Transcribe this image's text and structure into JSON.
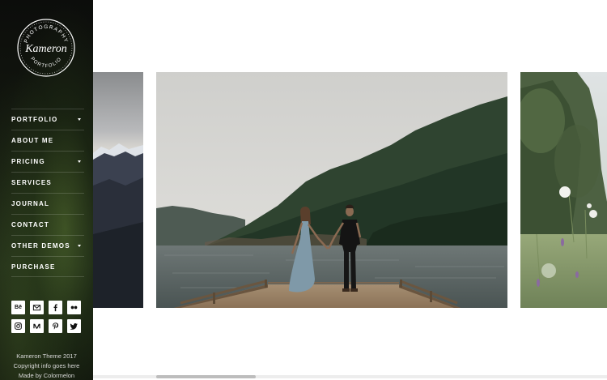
{
  "logo": {
    "top_text": "PHOTOGRAPHY",
    "script_text": "Kameron",
    "bottom_text": "PORTFOLIO"
  },
  "nav": [
    {
      "label": "PORTFOLIO",
      "has_dropdown": true
    },
    {
      "label": "ABOUT ME",
      "has_dropdown": false
    },
    {
      "label": "PRICING",
      "has_dropdown": true
    },
    {
      "label": "SERVICES",
      "has_dropdown": false
    },
    {
      "label": "JOURNAL",
      "has_dropdown": false
    },
    {
      "label": "CONTACT",
      "has_dropdown": false
    },
    {
      "label": "OTHER DEMOS",
      "has_dropdown": true
    },
    {
      "label": "PURCHASE",
      "has_dropdown": false
    }
  ],
  "social": {
    "behance": "Bē",
    "icons_row1": [
      "behance-icon",
      "envelope-icon",
      "facebook-icon",
      "flickr-icon"
    ],
    "icons_row2": [
      "instagram-icon",
      "medium-icon",
      "pinterest-icon",
      "twitter-icon"
    ]
  },
  "footer": {
    "line1": "Kameron Theme 2017",
    "line2": "Copyright info goes here",
    "line3": "Made by Colormelon"
  },
  "colors": {
    "sidebar_bg": "#111510",
    "text": "#ffffff",
    "accent": "#ffffff"
  },
  "gallery": {
    "images": [
      "mountain-sunset-image",
      "couple-on-pier-image",
      "wildflowers-image"
    ],
    "scroll_position": 0.12
  }
}
